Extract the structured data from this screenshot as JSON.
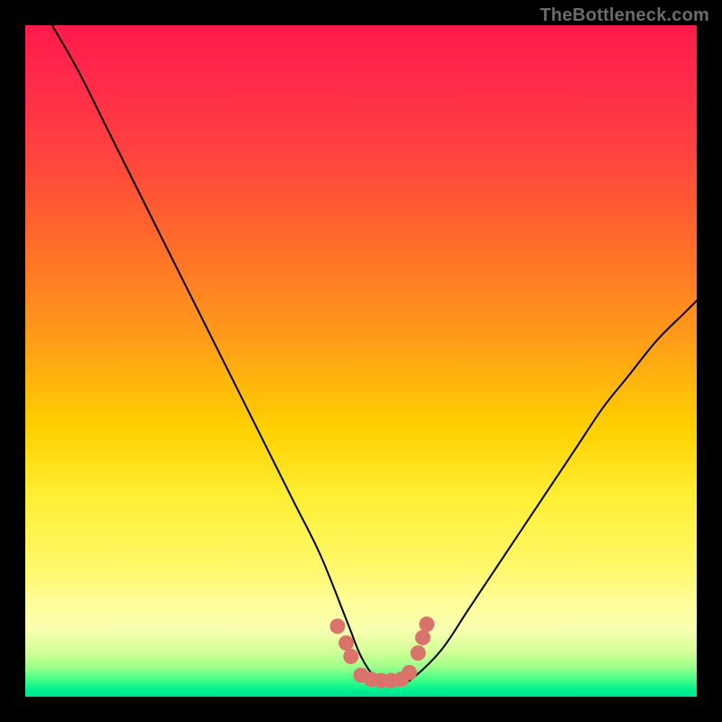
{
  "watermark": "TheBottleneck.com",
  "colors": {
    "frame": "#000000",
    "curve": "#000000",
    "marker": "#d9736b",
    "gradient_stops": [
      "#ff1a4d",
      "#ff2a4a",
      "#ff4040",
      "#ff6a2a",
      "#ff9a1a",
      "#ffd000",
      "#ffee33",
      "#fff866",
      "#fffd99",
      "#f8ffb0",
      "#d8ff9a",
      "#a0ff8a",
      "#40ff88",
      "#00f090",
      "#00e090"
    ]
  },
  "chart_data": {
    "type": "line",
    "title": "",
    "xlabel": "",
    "ylabel": "",
    "xlim": [
      0,
      100
    ],
    "ylim": [
      0,
      100
    ],
    "grid": false,
    "series": [
      {
        "name": "bottleneck-curve",
        "x": [
          4,
          8,
          12,
          16,
          20,
          24,
          28,
          32,
          36,
          40,
          44,
          48,
          50,
          52,
          54,
          56,
          58,
          62,
          66,
          70,
          74,
          78,
          82,
          86,
          90,
          94,
          98,
          100
        ],
        "y": [
          100,
          93,
          85,
          77,
          69,
          61,
          53,
          45,
          37,
          29,
          21,
          11,
          6,
          3,
          2,
          2,
          3,
          7,
          13,
          19,
          25,
          31,
          37,
          43,
          48,
          53,
          57,
          59
        ]
      }
    ],
    "markers": {
      "name": "highlighted-points",
      "x": [
        46.5,
        47.8,
        48.5,
        50.0,
        51.5,
        53.0,
        54.5,
        56.0,
        57.2,
        58.5,
        59.2,
        59.8
      ],
      "y": [
        10.5,
        8.0,
        6.0,
        3.2,
        2.6,
        2.4,
        2.4,
        2.6,
        3.6,
        6.5,
        8.8,
        10.8
      ]
    }
  }
}
